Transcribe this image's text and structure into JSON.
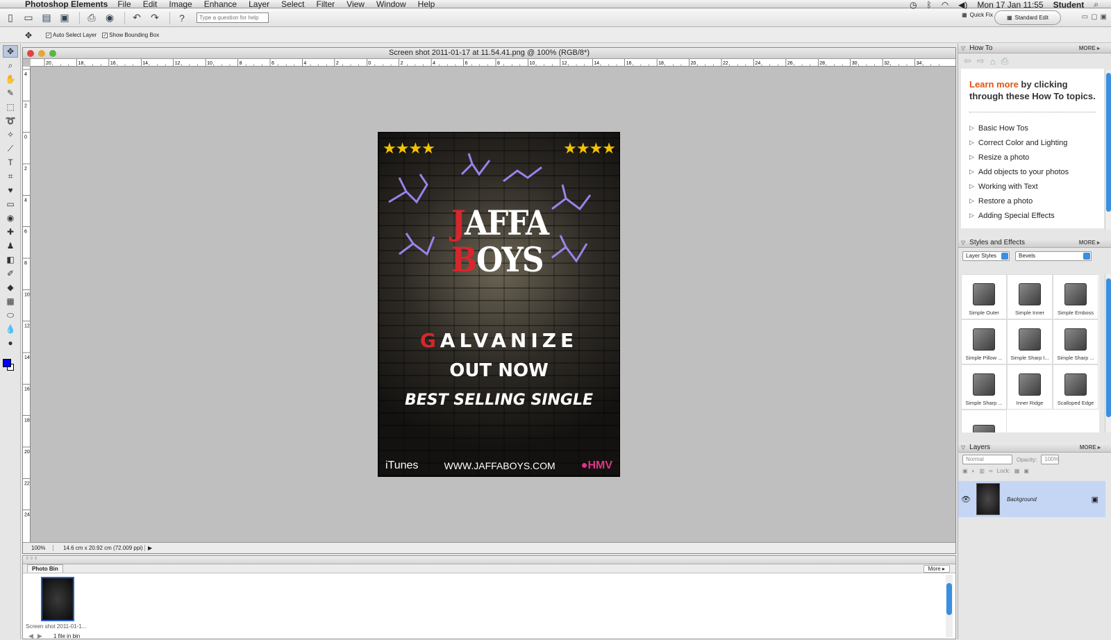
{
  "menubar": {
    "app_name": "Photoshop Elements",
    "items": [
      "File",
      "Edit",
      "Image",
      "Enhance",
      "Layer",
      "Select",
      "Filter",
      "View",
      "Window",
      "Help"
    ],
    "clock": "Mon 17 Jan  11:55",
    "user": "Student"
  },
  "toolbar": {
    "help_placeholder": "Type a question for help",
    "quick_fix": "Quick Fix",
    "standard_edit": "Standard Edit"
  },
  "options": {
    "auto_select_layer": "Auto Select Layer",
    "show_bounding_box": "Show Bounding Box"
  },
  "document": {
    "title": "Screen shot 2011-01-17 at 11.54.41.png @ 100% (RGB/8*)",
    "zoom": "100%",
    "info": "14.6 cm x 20.92 cm (72.009 ppi)",
    "ruler_h": [
      "20",
      "18",
      "16",
      "14",
      "12",
      "10",
      "8",
      "6",
      "4",
      "2",
      "0",
      "2",
      "4",
      "6",
      "8",
      "10",
      "12",
      "14",
      "16",
      "18",
      "20",
      "22",
      "24",
      "26",
      "28",
      "30",
      "32",
      "34"
    ],
    "ruler_v": [
      "4",
      "2",
      "0",
      "2",
      "4",
      "6",
      "8",
      "10",
      "12",
      "14",
      "16",
      "18",
      "20",
      "22",
      "24"
    ]
  },
  "poster": {
    "band_line1_a": "J",
    "band_line1_b": "AFFA",
    "band_line2_a": "B",
    "band_line2_b": "OYS",
    "single_a": "G",
    "single_b": "ALVANIZE",
    "out_now": "OUT NOW",
    "best_selling": "BEST SELLING SINGLE",
    "itunes": "iTunes",
    "url": "WWW.JAFFABOYS.COM",
    "hmv": "HMV",
    "stars": "★★★★"
  },
  "photobin": {
    "tab": "Photo Bin",
    "more": "More",
    "thumb_label": "Screen shot 2011-01-1...",
    "count": "1 file in bin"
  },
  "howto": {
    "title": "How To",
    "more": "MORE",
    "headline_orange": "Learn more",
    "headline_rest": " by clicking through these How To topics.",
    "topics": [
      "Basic How Tos",
      "Correct Color and Lighting",
      "Resize a photo",
      "Add objects to your photos",
      "Working with Text",
      "Restore a photo",
      "Adding Special Effects"
    ]
  },
  "styles": {
    "title": "Styles and Effects",
    "more": "MORE",
    "category": "Layer Styles",
    "subcategory": "Bevels",
    "items": [
      "Simple Outer",
      "Simple Inner",
      "Simple Emboss",
      "Simple Pillow ...",
      "Simple Sharp I...",
      "Simple Sharp ...",
      "Simple Sharp ...",
      "Inner Ridge",
      "Scalloped Edge",
      ""
    ]
  },
  "layers": {
    "title": "Layers",
    "more": "MORE",
    "blend_mode": "Normal",
    "opacity_label": "Opacity:",
    "opacity_value": "100%",
    "lock_label": "Lock:",
    "layer_name": "Background"
  },
  "colors": {
    "foreground": "#0000ff",
    "background": "#ffffff",
    "accent": "#3a8fe0",
    "howto_orange": "#e3530f"
  }
}
